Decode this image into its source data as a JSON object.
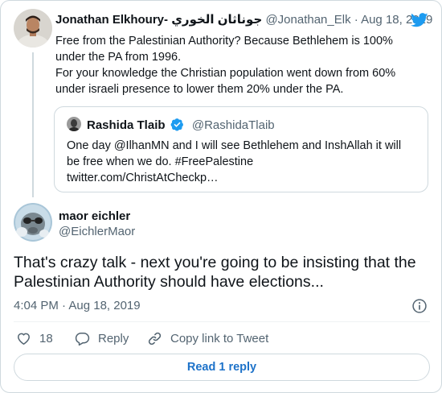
{
  "parent_tweet": {
    "author_name": "Jonathan Elkhoury- جوناثان الخوري",
    "meta": "@Jonathan_Elk · Aug 18, 2019",
    "text_lines": [
      "Free from the Palestinian Authority? Because Bethlehem is 100%",
      "under the PA from 1996.",
      "For your knowledge the Christian population went down from 60%",
      "under israeli presence to lower them 20% under the PA."
    ]
  },
  "quoted_tweet": {
    "author_name": "Rashida Tlaib",
    "handle": "@RashidaTlaib",
    "text_lines": [
      "One day @IlhanMN and I will see Bethlehem and InshAllah it will",
      "be free when we do. #FreePalestine",
      "twitter.com/ChristAtCheckp…"
    ]
  },
  "main_tweet": {
    "author_name": "maor eichler",
    "handle": "@EichlerMaor",
    "text_lines": [
      "That's crazy talk - next you're going to be insisting that the",
      "Palestinian Authority should have elections..."
    ],
    "timestamp": "4:04 PM · Aug 18, 2019"
  },
  "actions": {
    "like_count": "18",
    "reply_label": "Reply",
    "copy_label": "Copy link to Tweet"
  },
  "read_replies_label": "Read 1 reply",
  "colors": {
    "accent": "#1d9bf0",
    "link_text": "#1d72c9",
    "secondary_text": "#536471",
    "border": "#cfd9de"
  },
  "icons": [
    "twitter-bird-icon",
    "verified-badge-icon",
    "info-icon",
    "heart-icon",
    "reply-icon",
    "link-icon"
  ]
}
